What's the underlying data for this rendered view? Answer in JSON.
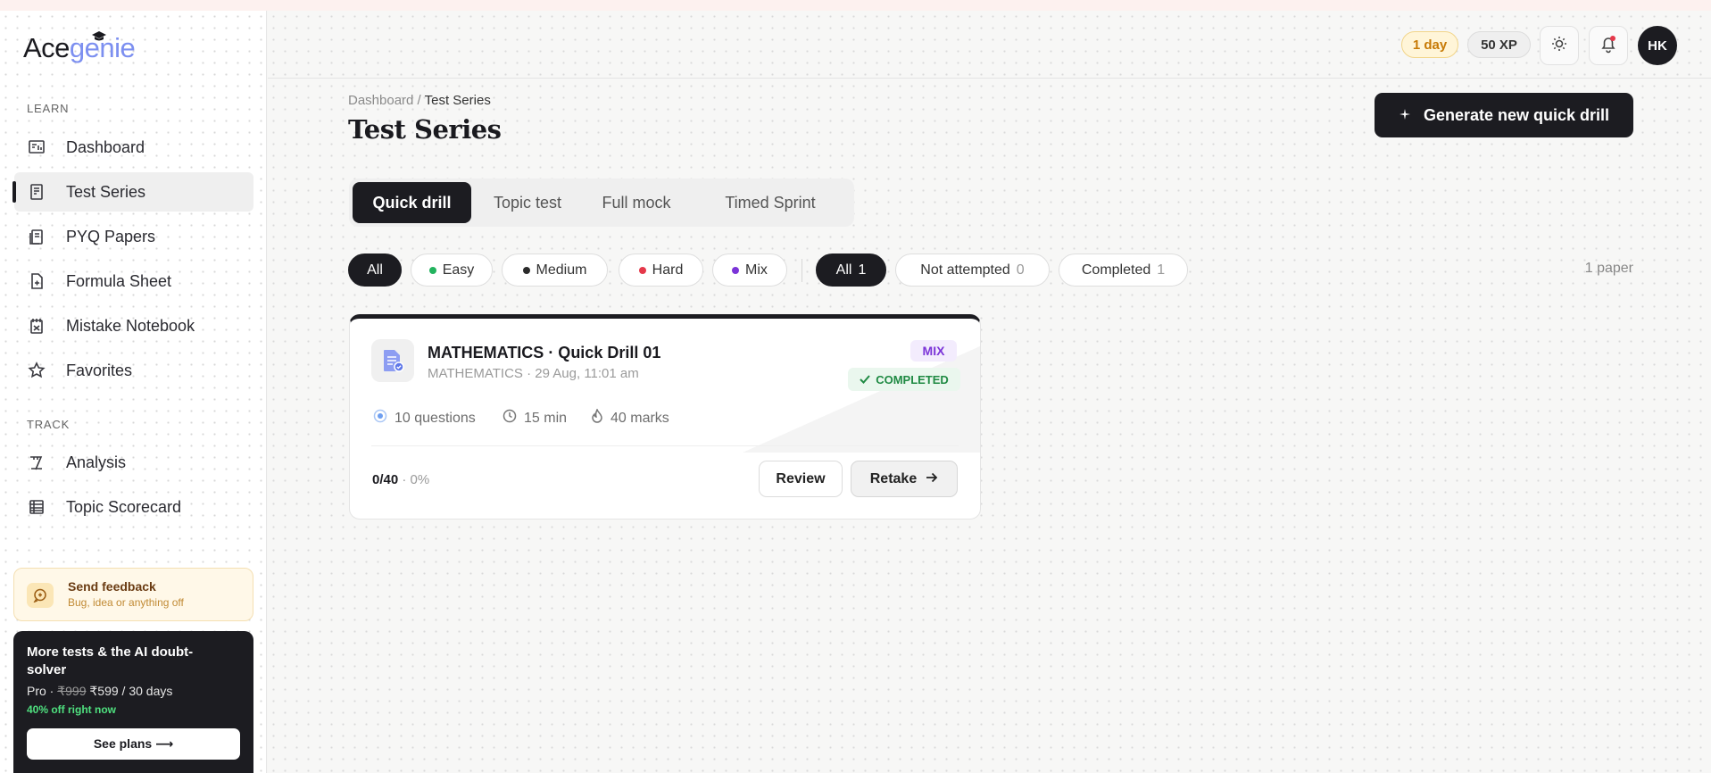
{
  "brand": {
    "part1": "Ace",
    "part2": "genie"
  },
  "sidebar": {
    "learn_label": "LEARN",
    "track_label": "TRACK",
    "learn_items": [
      {
        "label": "Dashboard",
        "icon": "dashboard-icon"
      },
      {
        "label": "Test Series",
        "icon": "test-series-icon",
        "active": true
      },
      {
        "label": "PYQ Papers",
        "icon": "papers-icon"
      },
      {
        "label": "Formula Sheet",
        "icon": "formula-sheet-icon"
      },
      {
        "label": "Mistake Notebook",
        "icon": "mistake-notebook-icon"
      },
      {
        "label": "Favorites",
        "icon": "star-icon"
      }
    ],
    "track_items": [
      {
        "label": "Analysis",
        "icon": "analysis-icon"
      },
      {
        "label": "Topic Scorecard",
        "icon": "scorecard-icon"
      }
    ],
    "feedback": {
      "title": "Send feedback",
      "subtitle": "Bug, idea or anything off"
    },
    "promo": {
      "headline": "More tests & the AI doubt-solver",
      "plan": "Pro · ",
      "old_price": "₹999",
      "new_price": " ₹599 / 30 days",
      "discount": "40% off right now",
      "cta": "See plans ⟶"
    }
  },
  "header": {
    "streak": "1 day",
    "xp": "50 XP",
    "avatar_initials": "HK"
  },
  "breadcrumb": {
    "parent": "Dashboard",
    "separator": " / ",
    "current": "Test Series"
  },
  "page_title": "Test Series",
  "generate_button": "Generate new quick drill",
  "tabs": [
    "Quick drill",
    "Topic test",
    "Full mock",
    "Timed Sprint"
  ],
  "difficulty_filters": [
    {
      "label": "All",
      "active": true
    },
    {
      "label": "Easy",
      "dot": "#22b35e"
    },
    {
      "label": "Medium",
      "dot": "#2b2b2b"
    },
    {
      "label": "Hard",
      "dot": "#e5384a"
    },
    {
      "label": "Mix",
      "dot": "#7b34d8"
    }
  ],
  "status_filters": [
    {
      "label": "All",
      "count": "1",
      "active": true
    },
    {
      "label": "Not attempted",
      "count": "0"
    },
    {
      "label": "Completed",
      "count": "1"
    }
  ],
  "paper_count": "1 paper",
  "card": {
    "title": "MATHEMATICS · Quick Drill 01",
    "subtitle": "MATHEMATICS · 29 Aug, 11:01 am",
    "difficulty_badge": "MIX",
    "status_badge": "COMPLETED",
    "questions": "10 questions",
    "duration": "15 min",
    "marks": "40 marks",
    "score": "0/40",
    "percent": " · 0%",
    "review_label": "Review",
    "retake_label": "Retake"
  },
  "colors": {
    "accent_dark": "#1c1c21",
    "brand_light": "#7c8ff0",
    "success": "#1f8a43",
    "mix_purple": "#7b34d8",
    "streak_amber": "#c77a06"
  }
}
